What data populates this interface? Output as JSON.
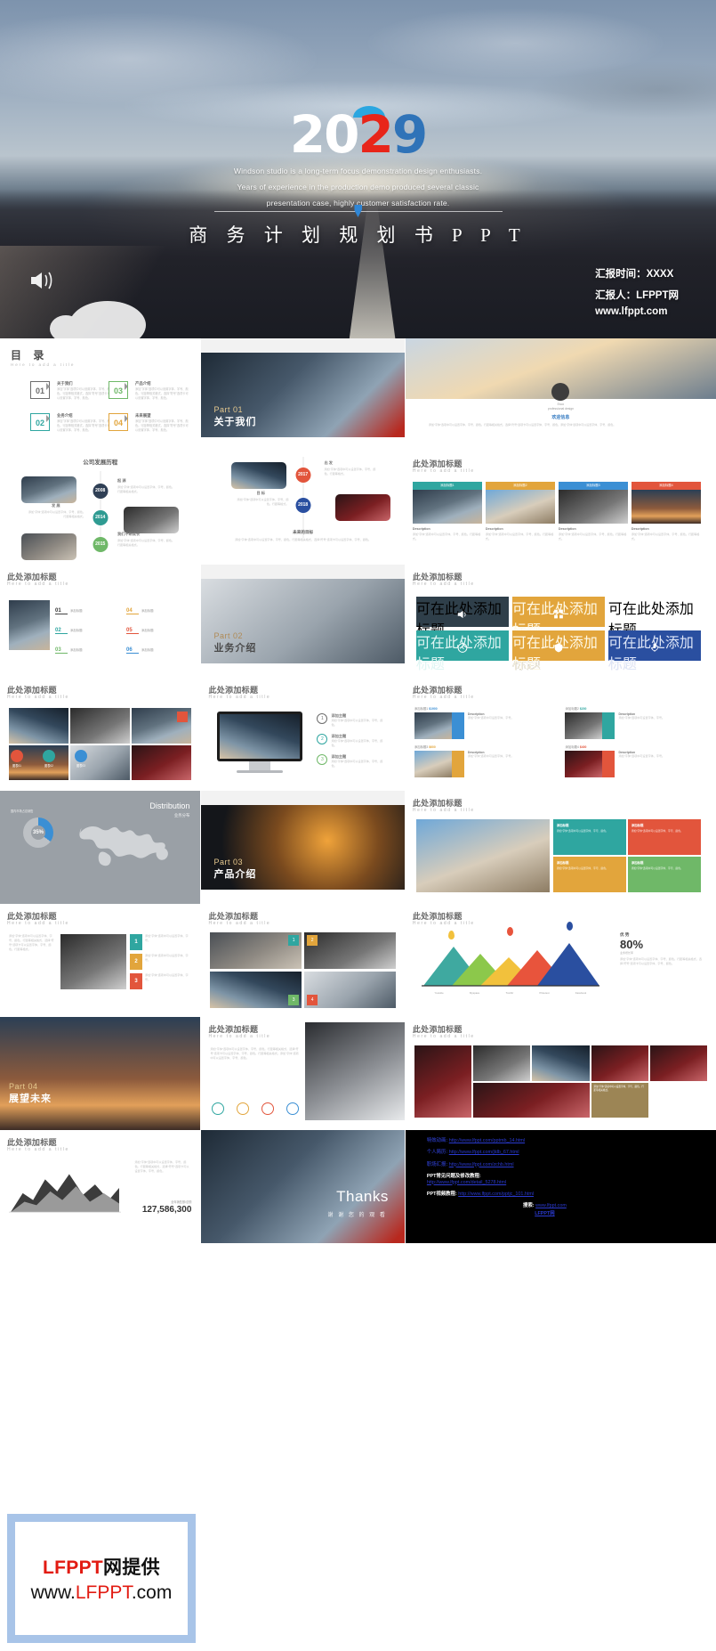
{
  "hero": {
    "year_parts": [
      "2",
      "0",
      "2",
      "9"
    ],
    "subtitle_lines": [
      "Windson studio is a long-term focus demonstration design enthusiasts.",
      "Years of experience in the production demo produced several classic",
      "presentation case, highly customer satisfaction rate."
    ],
    "title": "商 务 计 划 规 划 书 P P T",
    "report_time": "汇报时间：XXXX",
    "reporter": "汇报人：LFPPT网",
    "site": "www.lfppt.com",
    "colors": {
      "white": "#ffffff",
      "red": "#e8251a",
      "blue": "#2f73b8",
      "cap_blue": "#2ba6e0"
    }
  },
  "slides": {
    "toc": {
      "title": "目  录",
      "subtitle": "Here to add a title",
      "items": [
        {
          "num": "01",
          "label": "关于我们",
          "desc": "添加\"字体\"选项中可以设置字体、字号、颜色。行距等相关格式，选择\"符号\"选项卡可以设置字体、字号、颜色。",
          "color": "#6d6d6d"
        },
        {
          "num": "02",
          "label": "业务介绍",
          "desc": "添加\"字体\"选项中可以设置字体、字号、颜色。行距等相关格式，选择\"符号\"选项卡可以设置字体、字号、颜色。",
          "color": "#2fa6a0"
        },
        {
          "num": "03",
          "label": "产品介绍",
          "desc": "添加\"字体\"选项中可以设置字体、字号、颜色。行距等相关格式，选择\"符号\"选项卡可以设置字体、字号、颜色。",
          "color": "#6fb868"
        },
        {
          "num": "04",
          "label": "未来展望",
          "desc": "添加\"字体\"选项中可以设置字体、字号、颜色。行距等相关格式，选择\"符号\"选项卡可以设置字体、字号、颜色。",
          "color": "#e2a53c"
        }
      ]
    },
    "part01": {
      "number": "Part 01",
      "title": "关于我们"
    },
    "part02": {
      "number": "Part 02",
      "title": "业务介绍"
    },
    "part03": {
      "number": "Part 03",
      "title": "产品介绍"
    },
    "part04": {
      "number": "Part 04",
      "title": "展望未来"
    },
    "welcome": {
      "line1": "Esco",
      "line2": "professional design",
      "heading": "欢迎信息",
      "body": "添加\"字体\"选项中可以设置字体、字号、颜色。行距等相关格式，选择\"符号\"选项卡可以设置字体、字号、颜色。添加\"字体\"选项中可以设置字体、字号、颜色。"
    },
    "history": {
      "title": "公司发展历程",
      "events": [
        {
          "year": "2008",
          "label": "起  源",
          "color": "#2f3f55"
        },
        {
          "year": "2014",
          "label": "发  展",
          "color": "#2f9b92"
        },
        {
          "year": "2015",
          "label": "我们不断成长",
          "color": "#6fb868"
        },
        {
          "year": "2017",
          "label": "出  发",
          "color": "#e2553c"
        },
        {
          "year": "2018",
          "label": "目  标",
          "color": "#2a4fa0"
        }
      ],
      "footer": "未来的目标"
    },
    "generic_title": "此处添加标题",
    "generic_sub": "Here to add a title",
    "four_photos": {
      "tabs": [
        {
          "label": "添加标题1",
          "color": "#2fa6a0"
        },
        {
          "label": "添加标题2",
          "color": "#e2a53c"
        },
        {
          "label": "添加标题3",
          "color": "#3b8fd4"
        },
        {
          "label": "添加标题4",
          "color": "#e2553c"
        }
      ],
      "caption": "Description"
    },
    "numbered_list": {
      "items": [
        "01",
        "02",
        "03",
        "04",
        "05",
        "06"
      ],
      "label": "添加标题"
    },
    "icon_grid": {
      "cells": [
        {
          "label": "可在此处添加标题",
          "icon": "speaker-icon",
          "color": "#2f3f4a"
        },
        {
          "label": "可在此处添加标题",
          "icon": "grid-icon",
          "color": "#e2a53c"
        },
        {
          "label": "可在此处添加标题",
          "icon": "clock-icon",
          "color": "#2fa6a0"
        },
        {
          "label": "可在此处添加标题",
          "icon": "squares-icon",
          "color": "#e2553c"
        },
        {
          "label": "可在此处添加标题",
          "icon": "shield-icon",
          "color": "#e2a53c"
        },
        {
          "label": "可在此处添加标题",
          "icon": "mic-icon",
          "color": "#2a4fa0"
        }
      ]
    },
    "photo_badges": {
      "items": [
        {
          "label": "图表01",
          "color": "#e2553c"
        },
        {
          "label": "图表02",
          "color": "#2fa6a0"
        },
        {
          "label": "图表03",
          "color": "#3b8fd4"
        }
      ]
    },
    "monitor_list": {
      "items": [
        {
          "num": "1",
          "label": "添加主题",
          "color": "#6d6d6d"
        },
        {
          "num": "2",
          "label": "添加主题",
          "color": "#2fa6a0"
        },
        {
          "num": "3",
          "label": "添加主题",
          "color": "#6fb868"
        }
      ]
    },
    "price_cards": {
      "cards": [
        {
          "title": "添加标题1",
          "price": "$1900",
          "caption": "Description",
          "color": "#3b8fd4"
        },
        {
          "title": "添加标题2",
          "price": "$200",
          "caption": "Description",
          "color": "#2fa6a0"
        },
        {
          "title": "添加标题3",
          "price": "$600",
          "caption": "Description",
          "color": "#e2a53c"
        },
        {
          "title": "添加标题4",
          "price": "$400",
          "caption": "Description",
          "color": "#e2553c"
        }
      ]
    },
    "distribution": {
      "title": "Distribution",
      "subtitle": "业务分布",
      "percent": "35%",
      "note": "国内市场占总销售"
    },
    "four_color_blocks": {
      "blocks": [
        {
          "label": "添加标题",
          "color": "#2fa6a0"
        },
        {
          "label": "添加标题",
          "color": "#e2553c"
        },
        {
          "label": "添加标题",
          "color": "#e2a53c"
        },
        {
          "label": "添加标题",
          "color": "#6fb868"
        }
      ]
    },
    "mountain_chart": {
      "heading": "优  势",
      "percent": "80%",
      "sub": "业务增长率",
      "labels": [
        "Youtube",
        "Myspace",
        "Tumblr",
        "Pinterest",
        "Facebook"
      ],
      "body": "添加\"字体\"选项中可以设置字体、字号、颜色。行距等相关格式，选择\"符号\"选项卡可以设置字体、字号、颜色。"
    },
    "numbered_photos": {
      "items": [
        "1",
        "2",
        "3",
        "4"
      ]
    },
    "side_numbers": {
      "items": [
        {
          "num": "1",
          "color": "#2fa6a0"
        },
        {
          "num": "2",
          "color": "#e2a53c"
        },
        {
          "num": "3",
          "color": "#e2553c"
        }
      ]
    },
    "stat_chart": {
      "label": "全年销售额/总额",
      "value": "127,586,300"
    },
    "thanks": {
      "title": "Thanks",
      "subtitle": "谢 谢 您 的 观 看"
    },
    "links": [
      {
        "label": "特效动画:",
        "url": "http://www.lfppt.com/pptmb_14.html",
        "style": "link"
      },
      {
        "label": "个人简历:",
        "url": "http://www.lfppt.com/jldb_67.html",
        "style": "link"
      },
      {
        "label": "职场汇报:",
        "url": "http://www.lfppt.com/zchb.html",
        "style": "link"
      },
      {
        "label": "PPT常见问题及修改教程:",
        "url": "http://www.lfppt.com/detail_5278.html",
        "style": "white-label"
      },
      {
        "label": "PPT视频教程:",
        "url": "http://www.lfppt.com/pptjc_101.html",
        "style": "white-label"
      },
      {
        "label": "搜索:",
        "url": "www.lfppt.com",
        "style": "center"
      },
      {
        "label": "",
        "url": "LFPPT网",
        "style": "center"
      }
    ]
  },
  "watermark": {
    "line1_red": "LFPPT",
    "line1_black": "网提供",
    "line2_a": "www.",
    "line2_red": "LFPPT",
    "line2_b": ".com"
  }
}
